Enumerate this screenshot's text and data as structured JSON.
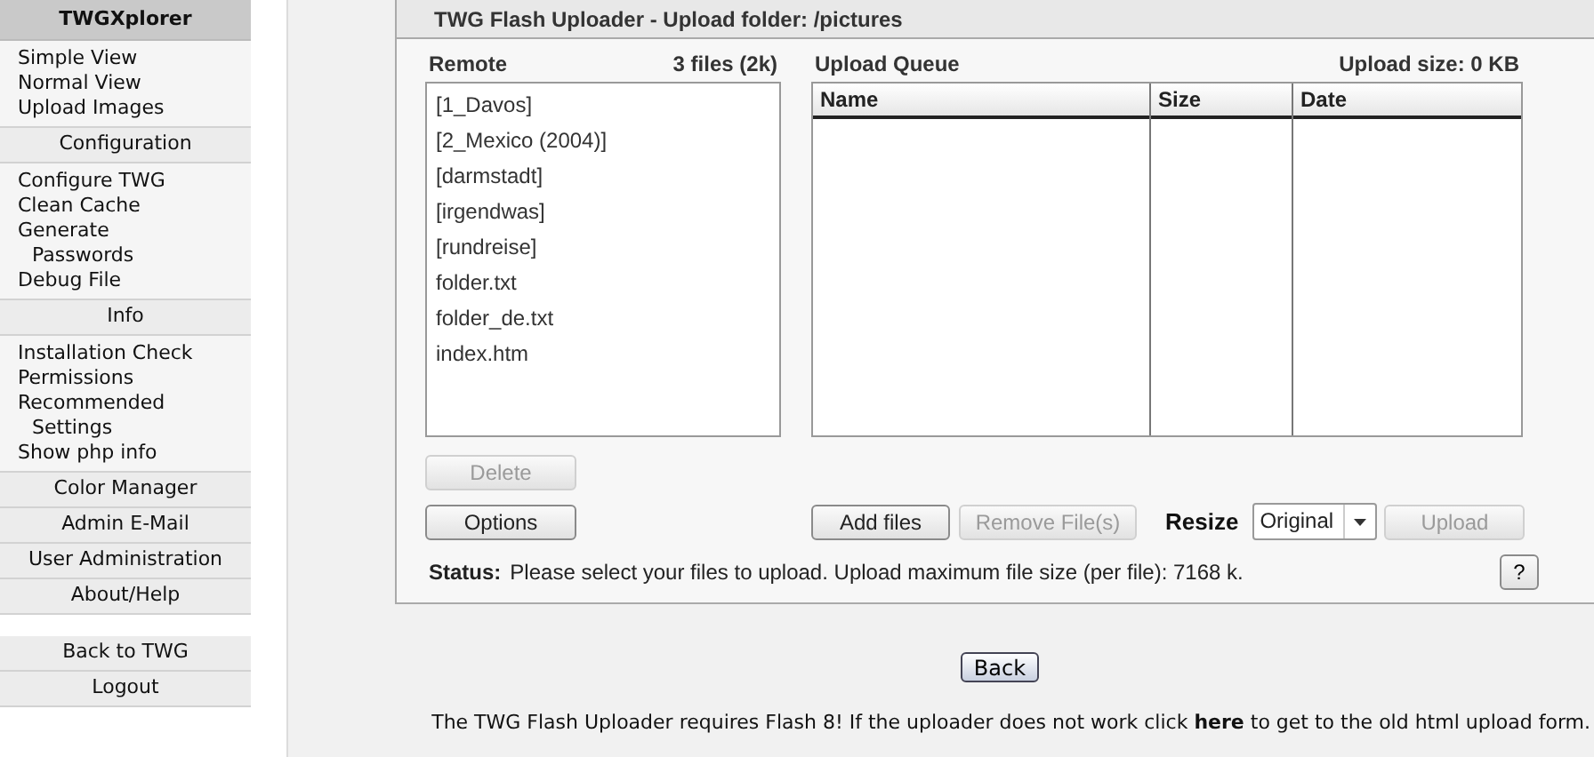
{
  "sidebar": {
    "sections": [
      {
        "kind": "title",
        "label": "TWGXplorer"
      },
      {
        "kind": "links",
        "items": [
          "Simple View",
          "Normal View",
          "Upload Images"
        ]
      },
      {
        "kind": "header",
        "label": "Configuration"
      },
      {
        "kind": "links",
        "items": [
          "Configure TWG",
          "Clean Cache",
          "Generate Passwords",
          "Debug File"
        ]
      },
      {
        "kind": "header",
        "label": "Info"
      },
      {
        "kind": "links",
        "items": [
          "Installation Check",
          "Permissions",
          "Recommended Settings",
          "Show php info"
        ]
      },
      {
        "kind": "header",
        "label": "Color Manager"
      },
      {
        "kind": "header",
        "label": "Admin E-Mail"
      },
      {
        "kind": "header",
        "label": "User Administration"
      },
      {
        "kind": "header",
        "label": "About/Help"
      },
      {
        "kind": "gap"
      },
      {
        "kind": "header",
        "label": "Back to TWG"
      },
      {
        "kind": "header",
        "label": "Logout"
      }
    ]
  },
  "uploader": {
    "title": "TWG Flash Uploader - Upload folder: /pictures",
    "remote": {
      "label": "Remote",
      "summary": "3 files (2k)",
      "files": [
        "[1_Davos]",
        "[2_Mexico (2004)]",
        "[darmstadt]",
        "[irgendwas]",
        "[rundreise]",
        "folder.txt",
        "folder_de.txt",
        "index.htm"
      ]
    },
    "queue": {
      "label": "Upload Queue",
      "summary": "Upload size: 0 KB",
      "columns": [
        "Name",
        "Size",
        "Date"
      ]
    },
    "delete_button": {
      "label": "Delete",
      "disabled": true
    },
    "options_button": {
      "label": "Options",
      "disabled": false
    },
    "add_button": {
      "label": "Add files",
      "disabled": false
    },
    "remove_button": {
      "label": "Remove File(s)",
      "disabled": true
    },
    "resize": {
      "label": "Resize",
      "value": "Original"
    },
    "upload_button": {
      "label": "Upload",
      "disabled": true
    },
    "status": {
      "label": "Status:",
      "text": "Please select your files to upload. Upload maximum file size (per file): 7168 k."
    },
    "help_button": "?"
  },
  "back_button": "Back",
  "footer": "The TWG Flash Uploader requires Flash 8! If the uploader does not work click **here** to get to the old html upload form."
}
